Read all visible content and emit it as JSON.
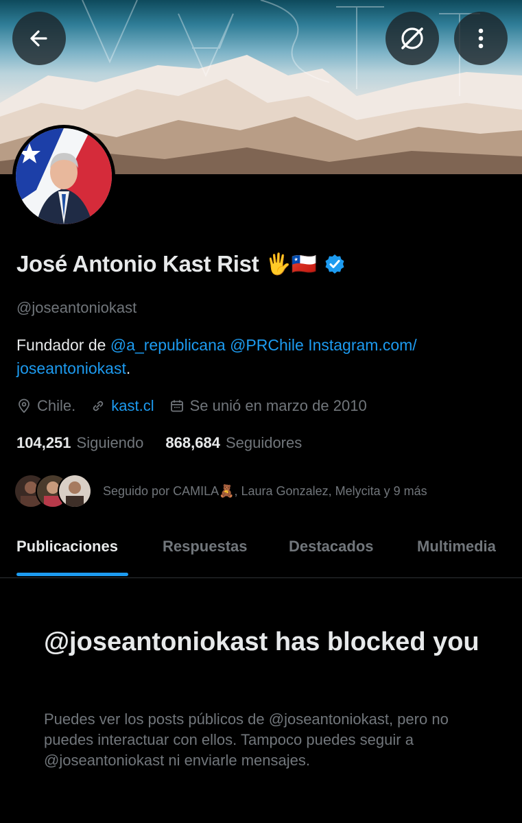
{
  "header": {
    "back_icon": "arrow-left-icon",
    "grok_icon": "grok-icon",
    "more_icon": "vertical-ellipsis-icon"
  },
  "profile": {
    "name": "José Antonio Kast Rist",
    "name_emojis": "🖐🇨🇱",
    "verified_icon": "verified-badge-icon",
    "handle": "@joseantoniokast",
    "bio": {
      "prefix": "Fundador de ",
      "mention1": "@a_republicana",
      "mention2": "@PRChile",
      "link_line1": "Instagram.com/",
      "link_line2": "joseantoniokast",
      "suffix": "."
    },
    "location": "Chile.",
    "website": "kast.cl",
    "joined": "Se unió en marzo de 2010",
    "following_count": "104,251",
    "following_label": "Siguiendo",
    "followers_count": "868,684",
    "followers_label": "Seguidores",
    "followed_by": "Seguido por CAMILA🧸, Laura Gonzalez, Melycita y 9 más"
  },
  "tabs": [
    {
      "label": "Publicaciones",
      "active": true
    },
    {
      "label": "Respuestas",
      "active": false
    },
    {
      "label": "Destacados",
      "active": false
    },
    {
      "label": "Multimedia",
      "active": false
    }
  ],
  "blocked": {
    "title": "@joseantoniokast has blocked you",
    "body": "Puedes ver los posts públicos de @joseantoniokast, pero no puedes interactuar con ellos. Tampoco puedes seguir a @joseantoniokast ni enviarle mensajes."
  },
  "colors": {
    "background": "#000000",
    "accent": "#1d9bf0",
    "secondary_text": "#71767b",
    "primary_text": "#e7e9ea"
  }
}
